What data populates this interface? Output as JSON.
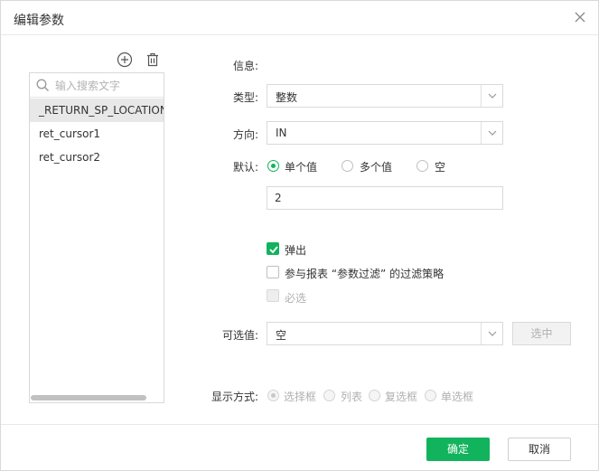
{
  "dialog": {
    "title": "编辑参数"
  },
  "param_list": {
    "search_placeholder": "输入搜索文字",
    "items": [
      "_RETURN_SP_LOCATION",
      "ret_cursor1",
      "ret_cursor2"
    ],
    "selected_index": 0
  },
  "form": {
    "info_label": "信息:",
    "type_label": "类型:",
    "type_value": "整数",
    "direction_label": "方向:",
    "direction_value": "IN",
    "default_label": "默认:",
    "default_options": [
      "单个值",
      "多个值",
      "空"
    ],
    "default_selected": "单个值",
    "default_value": "2",
    "popup_label": "弹出",
    "popup_checked": true,
    "filter_policy_label": "参与报表 “参数过滤” 的过滤策略",
    "filter_policy_checked": false,
    "required_label": "必选",
    "required_checked": false,
    "options_label": "可选值:",
    "options_value": "空",
    "select_button": "选中",
    "display_label": "显示方式:",
    "display_options": [
      "选择框",
      "列表",
      "复选框",
      "单选框"
    ],
    "display_selected": "选择框"
  },
  "footer": {
    "ok_label": "确定",
    "cancel_label": "取消"
  },
  "colors": {
    "accent": "#12b35d",
    "selected_row": "#e8e8e8",
    "border": "#d9d9d9"
  },
  "icons": [
    "close-icon",
    "add-icon",
    "trash-icon",
    "search-icon",
    "chevron-down-icon",
    "check-icon"
  ]
}
